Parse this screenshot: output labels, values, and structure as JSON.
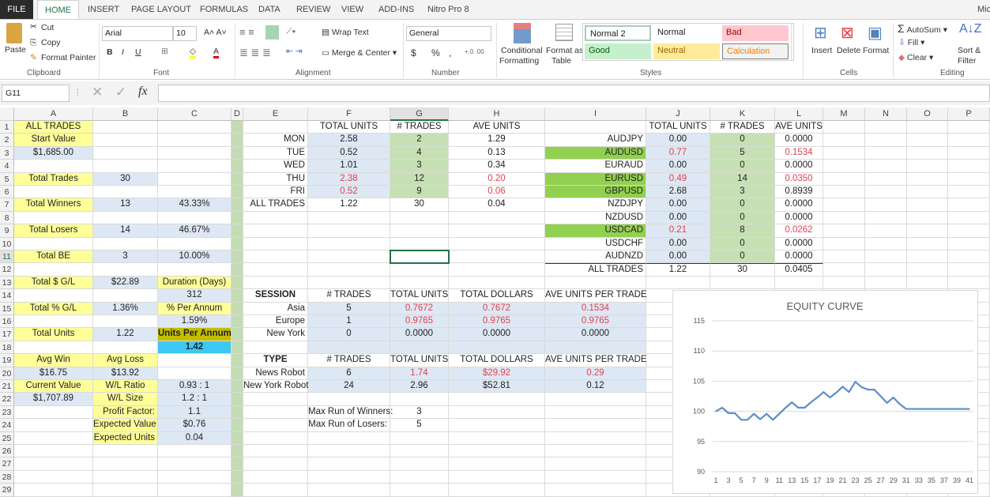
{
  "window": {
    "user": "Mic"
  },
  "tabs": [
    "FILE",
    "HOME",
    "INSERT",
    "PAGE LAYOUT",
    "FORMULAS",
    "DATA",
    "REVIEW",
    "VIEW",
    "ADD-INS",
    "Nitro Pro 8"
  ],
  "ribbon": {
    "clipboard": {
      "paste": "Paste",
      "cut": "Cut",
      "copy": "Copy",
      "format_painter": "Format Painter",
      "label": "Clipboard"
    },
    "font": {
      "name": "Arial",
      "size": "10",
      "bold": "B",
      "italic": "I",
      "underline": "U",
      "label": "Font"
    },
    "alignment": {
      "wrap": "Wrap Text",
      "merge": "Merge & Center",
      "label": "Alignment"
    },
    "number": {
      "format": "General",
      "currency": "$",
      "percent": "%",
      "comma": ",",
      "label": "Number"
    },
    "styles": {
      "conditional": "Conditional",
      "conditional2": "Formatting",
      "format_table": "Format as",
      "format_table2": "Table",
      "gallery": [
        "Normal 2",
        "Normal",
        "Bad",
        "Good",
        "Neutral",
        "Calculation"
      ],
      "label": "Styles"
    },
    "cells": {
      "insert": "Insert",
      "delete": "Delete",
      "format": "Format",
      "label": "Cells"
    },
    "editing": {
      "autosum": "AutoSum",
      "fill": "Fill",
      "clear": "Clear",
      "sort": "Sort &",
      "sort2": "Filter",
      "label": "Editing"
    }
  },
  "formula_bar": {
    "name_box": "G11",
    "fx": "fx",
    "value": ""
  },
  "columns": [
    "A",
    "B",
    "C",
    "D",
    "E",
    "F",
    "G",
    "H",
    "I",
    "J",
    "K",
    "L",
    "M",
    "N",
    "O",
    "P"
  ],
  "selected": "G11",
  "cells": [
    {
      "r": "A1",
      "v": "ALL TRADES",
      "s": "y"
    },
    {
      "r": "F1",
      "v": "TOTAL UNITS"
    },
    {
      "r": "G1",
      "v": "# TRADES"
    },
    {
      "r": "H1",
      "v": "AVE UNITS"
    },
    {
      "r": "J1",
      "v": "TOTAL UNITS"
    },
    {
      "r": "K1",
      "v": "# TRADES"
    },
    {
      "r": "L1",
      "v": "AVE UNITS"
    },
    {
      "r": "A2",
      "v": "Start Value",
      "s": "y"
    },
    {
      "r": "E2",
      "v": "MON",
      "s": "R"
    },
    {
      "r": "F2",
      "v": "2.58",
      "s": "b"
    },
    {
      "r": "G2",
      "v": "2",
      "s": "g"
    },
    {
      "r": "H2",
      "v": "1.29"
    },
    {
      "r": "I2",
      "v": "AUDJPY",
      "s": "R"
    },
    {
      "r": "J2",
      "v": "0.00",
      "s": "b"
    },
    {
      "r": "K2",
      "v": "0",
      "s": "g"
    },
    {
      "r": "L2",
      "v": "0.0000"
    },
    {
      "r": "A3",
      "v": "$1,685.00",
      "s": "b"
    },
    {
      "r": "E3",
      "v": "TUE",
      "s": "R"
    },
    {
      "r": "F3",
      "v": "0.52",
      "s": "b"
    },
    {
      "r": "G3",
      "v": "4",
      "s": "g"
    },
    {
      "r": "H3",
      "v": "0.13"
    },
    {
      "r": "I3",
      "v": "AUDUSD",
      "s": "R G"
    },
    {
      "r": "J3",
      "v": "0.77",
      "s": "b r"
    },
    {
      "r": "K3",
      "v": "5",
      "s": "g"
    },
    {
      "r": "L3",
      "v": "0.1534",
      "s": "r"
    },
    {
      "r": "E4",
      "v": "WED",
      "s": "R"
    },
    {
      "r": "F4",
      "v": "1.01",
      "s": "b"
    },
    {
      "r": "G4",
      "v": "3",
      "s": "g"
    },
    {
      "r": "H4",
      "v": "0.34"
    },
    {
      "r": "I4",
      "v": "EURAUD",
      "s": "R"
    },
    {
      "r": "J4",
      "v": "0.00",
      "s": "b"
    },
    {
      "r": "K4",
      "v": "0",
      "s": "g"
    },
    {
      "r": "L4",
      "v": "0.0000"
    },
    {
      "r": "A5",
      "v": "Total Trades",
      "s": "y"
    },
    {
      "r": "B5",
      "v": "30",
      "s": "b"
    },
    {
      "r": "E5",
      "v": "THU",
      "s": "R"
    },
    {
      "r": "F5",
      "v": "2.38",
      "s": "b r"
    },
    {
      "r": "G5",
      "v": "12",
      "s": "g"
    },
    {
      "r": "H5",
      "v": "0.20",
      "s": "r"
    },
    {
      "r": "I5",
      "v": "EURUSD",
      "s": "R G"
    },
    {
      "r": "J5",
      "v": "0.49",
      "s": "b r"
    },
    {
      "r": "K5",
      "v": "14",
      "s": "g"
    },
    {
      "r": "L5",
      "v": "0.0350",
      "s": "r"
    },
    {
      "r": "E6",
      "v": "FRI",
      "s": "R"
    },
    {
      "r": "F6",
      "v": "0.52",
      "s": "b r"
    },
    {
      "r": "G6",
      "v": "9",
      "s": "g"
    },
    {
      "r": "H6",
      "v": "0.06",
      "s": "r"
    },
    {
      "r": "I6",
      "v": "GBPUSD",
      "s": "R G"
    },
    {
      "r": "J6",
      "v": "2.68",
      "s": "b"
    },
    {
      "r": "K6",
      "v": "3",
      "s": "g"
    },
    {
      "r": "L6",
      "v": "0.8939"
    },
    {
      "r": "A7",
      "v": "Total Winners",
      "s": "y"
    },
    {
      "r": "B7",
      "v": "13",
      "s": "b"
    },
    {
      "r": "C7",
      "v": "43.33%",
      "s": "b"
    },
    {
      "r": "E7",
      "v": "ALL TRADES",
      "s": "R"
    },
    {
      "r": "F7",
      "v": "1.22"
    },
    {
      "r": "G7",
      "v": "30"
    },
    {
      "r": "H7",
      "v": "0.04"
    },
    {
      "r": "I7",
      "v": "NZDJPY",
      "s": "R"
    },
    {
      "r": "J7",
      "v": "0.00",
      "s": "b"
    },
    {
      "r": "K7",
      "v": "0",
      "s": "g"
    },
    {
      "r": "L7",
      "v": "0.0000"
    },
    {
      "r": "I8",
      "v": "NZDUSD",
      "s": "R"
    },
    {
      "r": "J8",
      "v": "0.00",
      "s": "b"
    },
    {
      "r": "K8",
      "v": "0",
      "s": "g"
    },
    {
      "r": "L8",
      "v": "0.0000"
    },
    {
      "r": "A9",
      "v": "Total Losers",
      "s": "y"
    },
    {
      "r": "B9",
      "v": "14",
      "s": "b"
    },
    {
      "r": "C9",
      "v": "46.67%",
      "s": "b"
    },
    {
      "r": "I9",
      "v": "USDCAD",
      "s": "R G"
    },
    {
      "r": "J9",
      "v": "0.21",
      "s": "b r"
    },
    {
      "r": "K9",
      "v": "8",
      "s": "g"
    },
    {
      "r": "L9",
      "v": "0.0262",
      "s": "r"
    },
    {
      "r": "I10",
      "v": "USDCHF",
      "s": "R"
    },
    {
      "r": "J10",
      "v": "0.00",
      "s": "b"
    },
    {
      "r": "K10",
      "v": "0",
      "s": "g"
    },
    {
      "r": "L10",
      "v": "0.0000"
    },
    {
      "r": "A11",
      "v": "Total BE",
      "s": "y"
    },
    {
      "r": "B11",
      "v": "3",
      "s": "b"
    },
    {
      "r": "C11",
      "v": "10.00%",
      "s": "b"
    },
    {
      "r": "I11",
      "v": "AUDNZD",
      "s": "R"
    },
    {
      "r": "J11",
      "v": "0.00",
      "s": "b"
    },
    {
      "r": "K11",
      "v": "0",
      "s": "g"
    },
    {
      "r": "L11",
      "v": "0.0000"
    },
    {
      "r": "I12",
      "v": "ALL TRADES",
      "s": "R tb"
    },
    {
      "r": "J12",
      "v": "1.22",
      "s": "tb"
    },
    {
      "r": "K12",
      "v": "30",
      "s": "tb"
    },
    {
      "r": "L12",
      "v": "0.0405",
      "s": "tb"
    },
    {
      "r": "A13",
      "v": "Total $ G/L",
      "s": "y"
    },
    {
      "r": "B13",
      "v": "$22.89",
      "s": "b"
    },
    {
      "r": "C13",
      "v": "Duration (Days)",
      "s": "y"
    },
    {
      "r": "C14",
      "v": "312",
      "s": "b"
    },
    {
      "r": "E14",
      "v": "SESSION",
      "s": "bd"
    },
    {
      "r": "F14",
      "v": "# TRADES"
    },
    {
      "r": "G14",
      "v": "TOTAL UNITS"
    },
    {
      "r": "H14",
      "v": "TOTAL DOLLARS"
    },
    {
      "r": "I14",
      "v": "AVE UNITS PER TRADE"
    },
    {
      "r": "A15",
      "v": "Total % G/L",
      "s": "y"
    },
    {
      "r": "B15",
      "v": "1.36%",
      "s": "b"
    },
    {
      "r": "C15",
      "v": "% Per Annum",
      "s": "y"
    },
    {
      "r": "E15",
      "v": "Asia",
      "s": "R"
    },
    {
      "r": "F15",
      "v": "5",
      "s": "b"
    },
    {
      "r": "G15",
      "v": "0.7672",
      "s": "b r"
    },
    {
      "r": "H15",
      "v": "0.7672",
      "s": "b r"
    },
    {
      "r": "I15",
      "v": "0.1534",
      "s": "b r"
    },
    {
      "r": "C16",
      "v": "1.59%",
      "s": "b"
    },
    {
      "r": "E16",
      "v": "Europe",
      "s": "R"
    },
    {
      "r": "F16",
      "v": "1",
      "s": "b"
    },
    {
      "r": "G16",
      "v": "0.9765",
      "s": "b r"
    },
    {
      "r": "H16",
      "v": "0.9765",
      "s": "b r"
    },
    {
      "r": "I16",
      "v": "0.9765",
      "s": "b r"
    },
    {
      "r": "A17",
      "v": "Total Units",
      "s": "y"
    },
    {
      "r": "B17",
      "v": "1.22",
      "s": "b"
    },
    {
      "r": "C17",
      "v": "Units Per Annum",
      "s": "ol"
    },
    {
      "r": "E17",
      "v": "New York",
      "s": "R"
    },
    {
      "r": "F17",
      "v": "0",
      "s": "b"
    },
    {
      "r": "G17",
      "v": "0.0000",
      "s": "b"
    },
    {
      "r": "H17",
      "v": "0.0000",
      "s": "b"
    },
    {
      "r": "I17",
      "v": "0.0000",
      "s": "b"
    },
    {
      "r": "C18",
      "v": "1.42",
      "s": "cy"
    },
    {
      "r": "F18",
      "v": "",
      "s": "b"
    },
    {
      "r": "G18",
      "v": "",
      "s": "b"
    },
    {
      "r": "H18",
      "v": "",
      "s": "b"
    },
    {
      "r": "I18",
      "v": "",
      "s": "b"
    },
    {
      "r": "A19",
      "v": "Avg Win",
      "s": "y"
    },
    {
      "r": "B19",
      "v": "Avg Loss",
      "s": "y"
    },
    {
      "r": "E19",
      "v": "TYPE",
      "s": "bd"
    },
    {
      "r": "F19",
      "v": "# TRADES"
    },
    {
      "r": "G19",
      "v": "TOTAL UNITS"
    },
    {
      "r": "H19",
      "v": "TOTAL DOLLARS"
    },
    {
      "r": "I19",
      "v": "AVE UNITS PER TRADE"
    },
    {
      "r": "A20",
      "v": "$16.75",
      "s": "b"
    },
    {
      "r": "B20",
      "v": "$13.92",
      "s": "b"
    },
    {
      "r": "E20",
      "v": "News Robot",
      "s": "R"
    },
    {
      "r": "F20",
      "v": "6",
      "s": "b"
    },
    {
      "r": "G20",
      "v": "1.74",
      "s": "b r"
    },
    {
      "r": "H20",
      "v": "$29.92",
      "s": "b r"
    },
    {
      "r": "I20",
      "v": "0.29",
      "s": "b r"
    },
    {
      "r": "A21",
      "v": "Current Value",
      "s": "y"
    },
    {
      "r": "B21",
      "v": "W/L Ratio",
      "s": "y"
    },
    {
      "r": "C21",
      "v": "0.93 : 1",
      "s": "b"
    },
    {
      "r": "E21",
      "v": "New York Robot",
      "s": "R"
    },
    {
      "r": "F21",
      "v": "24",
      "s": "b"
    },
    {
      "r": "G21",
      "v": "2.96",
      "s": "b"
    },
    {
      "r": "H21",
      "v": "$52.81",
      "s": "b"
    },
    {
      "r": "I21",
      "v": "0.12",
      "s": "b"
    },
    {
      "r": "A22",
      "v": "$1,707.89",
      "s": "b"
    },
    {
      "r": "B22",
      "v": "W/L Size",
      "s": "y"
    },
    {
      "r": "C22",
      "v": "1.2 : 1",
      "s": "b"
    },
    {
      "r": "B23",
      "v": "Profit Factor:",
      "s": "y R"
    },
    {
      "r": "C23",
      "v": "1.1",
      "s": "b"
    },
    {
      "r": "F23",
      "v": "Max Run of Winners:",
      "s": "R"
    },
    {
      "r": "G23",
      "v": "3"
    },
    {
      "r": "B24",
      "v": "Expected Value",
      "s": "y R"
    },
    {
      "r": "C24",
      "v": "$0.76",
      "s": "b"
    },
    {
      "r": "F24",
      "v": "Max Run of Losers:",
      "s": "R"
    },
    {
      "r": "G24",
      "v": "5"
    },
    {
      "r": "B25",
      "v": "Expected Units",
      "s": "y R"
    },
    {
      "r": "C25",
      "v": "0.04",
      "s": "b"
    }
  ],
  "chart_data": {
    "type": "line",
    "title": "EQUITY CURVE",
    "x": [
      1,
      2,
      3,
      4,
      5,
      6,
      7,
      8,
      9,
      10,
      11,
      12,
      13,
      14,
      15,
      16,
      17,
      18,
      19,
      20,
      21,
      22,
      23,
      24,
      25,
      26,
      27,
      28,
      29,
      30,
      31,
      32,
      33,
      34,
      35,
      36,
      37,
      38,
      39,
      40,
      41
    ],
    "series": [
      {
        "name": "Equity",
        "color": "#5b8fc7",
        "values": [
          100,
          100.6,
          99.7,
          99.7,
          98.6,
          98.6,
          99.6,
          98.7,
          99.6,
          98.6,
          99.6,
          100.6,
          101.5,
          100.6,
          100.6,
          101.5,
          102.3,
          103.2,
          102.3,
          103.1,
          104.1,
          103.2,
          104.9,
          104.0,
          103.6,
          103.6,
          102.5,
          101.4,
          102.3,
          101.2,
          100.4,
          100.4,
          100.4,
          100.4,
          100.4,
          100.4,
          100.4,
          100.4,
          100.4,
          100.4,
          100.4
        ]
      }
    ],
    "ylim": [
      90,
      115
    ],
    "yticks": [
      "90",
      "95",
      "100",
      "105",
      "110",
      "115"
    ],
    "xticks": [
      "1",
      "3",
      "5",
      "7",
      "9",
      "11",
      "13",
      "15",
      "17",
      "19",
      "21",
      "23",
      "25",
      "27",
      "29",
      "31",
      "33",
      "35",
      "37",
      "39",
      "41"
    ],
    "grid": true,
    "legend": "none"
  }
}
